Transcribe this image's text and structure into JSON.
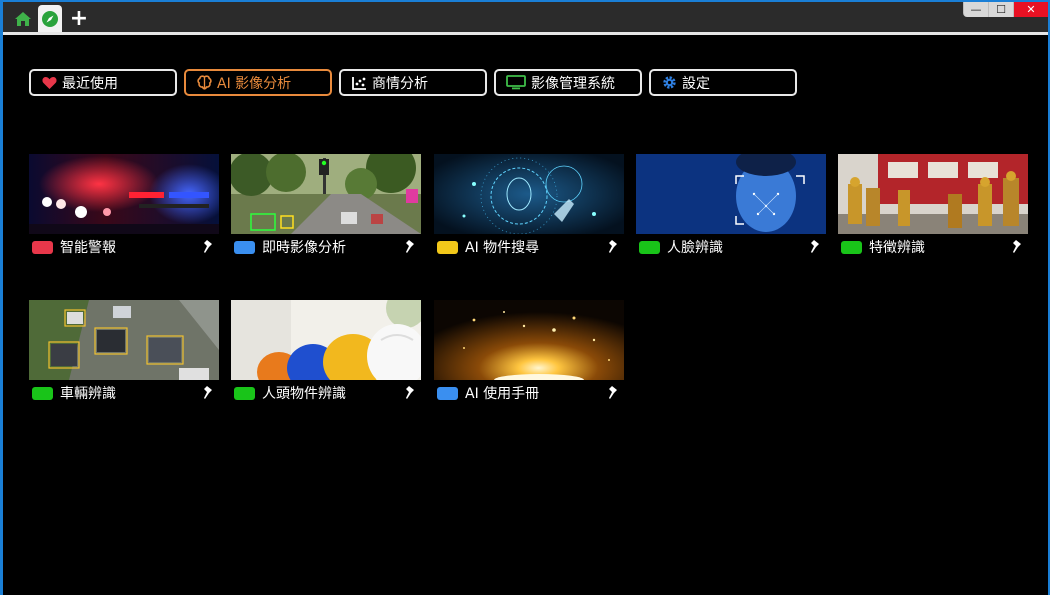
{
  "window": {
    "tabs": [
      {
        "name": "home-icon",
        "color": "#3fb24a"
      },
      {
        "name": "compass-icon",
        "color": "#2aa33c"
      }
    ],
    "add_tab_label": "+",
    "controls": {
      "minimize": "—",
      "maximize": "☐",
      "close": "✕"
    }
  },
  "nav": {
    "items": [
      {
        "label": "最近使用",
        "icon": "heart-icon",
        "icon_color": "#e8374a",
        "active": false
      },
      {
        "label": "AI 影像分析",
        "icon": "brain-icon",
        "icon_color": "#e88a3c",
        "active": true
      },
      {
        "label": "商情分析",
        "icon": "scatter-chart-icon",
        "icon_color": "#ffffff",
        "active": false
      },
      {
        "label": "影像管理系統",
        "icon": "monitor-icon",
        "icon_color": "#3fbf4a",
        "active": false
      },
      {
        "label": "設定",
        "icon": "gear-icon",
        "icon_color": "#2f7fe0",
        "active": false
      }
    ]
  },
  "cards": [
    {
      "label": "智能警報",
      "tag_color": "#e8374a",
      "image": "police-lights-image"
    },
    {
      "label": "即時影像分析",
      "tag_color": "#3a8ff0",
      "image": "street-traffic-image"
    },
    {
      "label": "AI 物件搜尋",
      "tag_color": "#f2c81a",
      "image": "ai-face-scan-image"
    },
    {
      "label": "人臉辨識",
      "tag_color": "#19c419",
      "image": "face-recognition-image"
    },
    {
      "label": "特徵辨識",
      "tag_color": "#19c419",
      "image": "firefighters-image"
    },
    {
      "label": "車輛辨識",
      "tag_color": "#19c419",
      "image": "vehicle-detection-image"
    },
    {
      "label": "人頭物件辨識",
      "tag_color": "#19c419",
      "image": "hard-hats-image"
    },
    {
      "label": "AI 使用手冊",
      "tag_color": "#3a8ff0",
      "image": "golden-light-image"
    }
  ]
}
